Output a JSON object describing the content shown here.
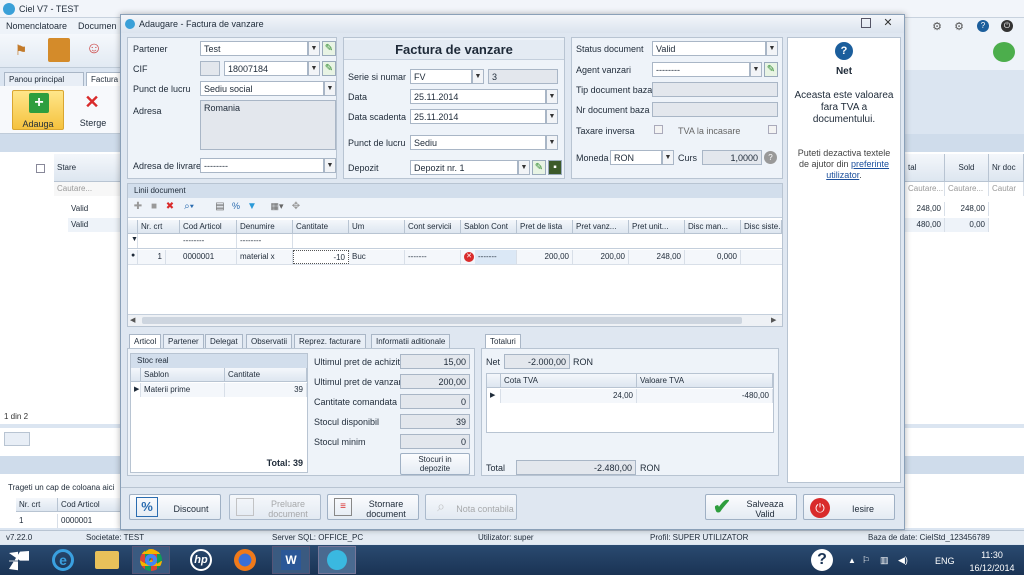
{
  "bg": {
    "app_title": "Ciel V7 - TEST",
    "menu": [
      "Nomenclatoare",
      "Documen"
    ],
    "tabs": [
      "Panou principal",
      "Factura"
    ],
    "toolbar": {
      "add": "Adauga",
      "delete": "Sterge"
    },
    "grid_headers": [
      "Stare"
    ],
    "filter_placeholder": "Cautare...",
    "rows": [
      {
        "stare": "Valid",
        "total": "248,00",
        "sold": "248,00"
      },
      {
        "stare": "Valid",
        "total": "480,00",
        "sold": "0,00"
      }
    ],
    "right_headers": [
      "tal",
      "Sold",
      "Nr doc"
    ],
    "right_filter": [
      "Cautare...",
      "Cautare...",
      "Cautar"
    ],
    "pager": "1 din 2",
    "group_hint": "Trageti un cap de coloana aici",
    "sub_headers": [
      "Nr. crt",
      "Cod Articol"
    ],
    "sub_row": [
      "1",
      "0000001"
    ],
    "status": {
      "version": "v7.22.0",
      "company": "Societate: TEST",
      "server": "Server SQL: OFFICE_PC",
      "user": "Utilizator: super",
      "profile": "Profil: SUPER UTILIZATOR",
      "db": "Baza de date: CielStd_123456789"
    }
  },
  "dialog": {
    "title": "Adaugare - Factura de vanzare",
    "doc_title": "Factura de vanzare",
    "partener": {
      "label": "Partener",
      "value": "Test"
    },
    "cif": {
      "label": "CIF",
      "value": "18007184"
    },
    "punct_lucru": {
      "label": "Punct de lucru",
      "value": "Sediu social"
    },
    "adresa": {
      "label": "Adresa",
      "value": "Romania"
    },
    "adresa_livrare": {
      "label": "Adresa de livrare",
      "value": "--------"
    },
    "serie": {
      "label": "Serie si numar",
      "serie": "FV",
      "numar": "3"
    },
    "data": {
      "label": "Data",
      "value": "25.11.2014"
    },
    "data_scadenta": {
      "label": "Data scadenta",
      "value": "25.11.2014"
    },
    "punct_lucru2": {
      "label": "Punct de lucru",
      "value": "Sediu"
    },
    "depozit": {
      "label": "Depozit",
      "value": "Depozit nr. 1"
    },
    "status_doc": {
      "label": "Status document",
      "value": "Valid"
    },
    "agent": {
      "label": "Agent vanzari",
      "value": "--------"
    },
    "tip_baza": {
      "label": "Tip document baza"
    },
    "nr_baza": {
      "label": "Nr document baza"
    },
    "taxare": {
      "label": "Taxare inversa",
      "tva_incasare": "TVA la incasare"
    },
    "moneda": {
      "label": "Moneda",
      "value": "RON",
      "curs_label": "Curs",
      "curs": "1,0000"
    },
    "lines_title": "Linii document",
    "columns": [
      "Nr. crt",
      "Cod Articol",
      "Denumire",
      "Cantitate",
      "Um",
      "Cont servicii",
      "Sablon Cont",
      "Pret de lista",
      "Pret vanz...",
      "Pret unit...",
      "Disc man...",
      "Disc siste..."
    ],
    "filter_dash": "--------",
    "line": {
      "nr": "1",
      "cod": "0000001",
      "denumire": "material x",
      "cantitate": "-10",
      "um": "Buc",
      "cont": "-------",
      "sablon": "-------",
      "pret_lista": "200,00",
      "pret_vanz": "200,00",
      "pret_unit": "248,00",
      "disc": "0,000"
    },
    "bottom_tabs": [
      "Articol",
      "Partener",
      "Delegat",
      "Observatii",
      "Reprez. facturare",
      "Informatii aditionale"
    ],
    "stoc": {
      "title": "Stoc real",
      "headers": [
        "Sablon",
        "Cantitate"
      ],
      "row": [
        "Materii prime",
        "39"
      ],
      "total": "Total: 39"
    },
    "info": [
      {
        "label": "Ultimul pret de achizitie",
        "value": "15,00"
      },
      {
        "label": "Ultimul pret de vanzare",
        "value": "200,00"
      },
      {
        "label": "Cantitate comandata",
        "value": "0"
      },
      {
        "label": "Stocul disponibil",
        "value": "39"
      },
      {
        "label": "Stocul minim",
        "value": "0"
      }
    ],
    "stocuri_btn": "Stocuri in depozite",
    "totals": {
      "tab": "Totaluri",
      "net_label": "Net",
      "net": "-2.000,00",
      "net_cur": "RON",
      "headers": [
        "Cota TVA",
        "Valoare TVA"
      ],
      "row": [
        "24,00",
        "-480,00"
      ],
      "total_label": "Total",
      "total": "-2.480,00",
      "total_cur": "RON"
    },
    "help": {
      "title": "Net",
      "text": "Aceasta este valoarea fara TVA a documentului.",
      "hint": "Puteti dezactiva textele de ajutor din",
      "link": "preferinte utilizator",
      "dot": "."
    },
    "buttons": {
      "discount": "Discount",
      "preluare": "Preluare document",
      "stornare": "Stornare document",
      "nota": "Nota contabila",
      "salveaza": "Salveaza Valid",
      "iesire": "Iesire"
    }
  },
  "taskbar": {
    "lang": "ENG",
    "time": "11:30",
    "date": "16/12/2014"
  },
  "colors": {
    "accent": "#2b6cb0",
    "green": "#2e9e3e",
    "red": "#d92b2b",
    "taskbar": "#1f3a5f"
  }
}
